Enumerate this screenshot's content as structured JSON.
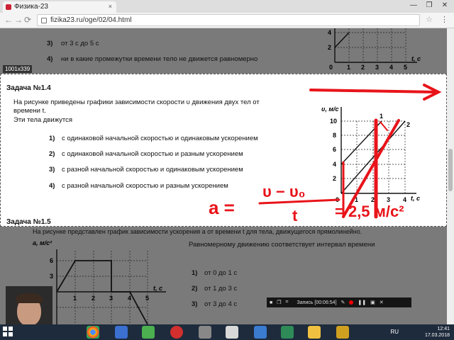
{
  "browser": {
    "tab_title": "Физика-23",
    "tab_close": "×",
    "url": "fizika23.ru/oge/02/04.html",
    "window_controls": [
      "—",
      "❐",
      "✕"
    ]
  },
  "overlay": {
    "size_tag": "1001x339"
  },
  "prev_task": {
    "options": [
      {
        "num": "3)",
        "text": "от 3 с до 5 с"
      },
      {
        "num": "4)",
        "text": "ни в какие промежутки времени тело не движется равномерно"
      }
    ],
    "graph": {
      "y_ticks": [
        "4",
        "2"
      ],
      "x_ticks": [
        "0",
        "1",
        "2",
        "3",
        "4",
        "5"
      ],
      "x_axis": "t, с"
    }
  },
  "task14": {
    "title": "Задача №1.4",
    "question_line1": "На рисунке приведены графики зависимости скорости υ движения двух тел от",
    "question_line2": "времени t.",
    "question_line3": "Эти тела движутся",
    "options": [
      {
        "num": "1)",
        "text": "с одинаковой начальной скоростью и одинаковым ускорением"
      },
      {
        "num": "2)",
        "text": "с одинаковой начальной скоростью и разным ускорением"
      },
      {
        "num": "3)",
        "text": "с разной начальной скоростью и одинаковым ускорением"
      },
      {
        "num": "4)",
        "text": "с разной начальной скоростью и разным ускорением"
      }
    ],
    "graph": {
      "y_axis": "υ, м/с",
      "y_ticks": [
        "10",
        "8",
        "6",
        "4",
        "2"
      ],
      "x_ticks": [
        "0",
        "1",
        "2",
        "3",
        "4"
      ],
      "x_axis": "t, с",
      "line_labels": [
        "1",
        "2"
      ]
    }
  },
  "task15": {
    "title": "Задача №1.5",
    "question": "На рисунке представлен график зависимости ускорения a от времени t для тела, движущегося прямолинейно.",
    "prompt": "Равномерному движению соответствует интервал времени",
    "options": [
      {
        "num": "1)",
        "text": "от 0 до 1 с"
      },
      {
        "num": "2)",
        "text": "от 1 до 3 с"
      },
      {
        "num": "3)",
        "text": "от 3 до 4 с"
      }
    ],
    "graph": {
      "y_axis": "a, м/с²",
      "y_ticks": [
        "6",
        "3"
      ],
      "x_ticks": [
        "1",
        "2",
        "3",
        "4",
        "5"
      ],
      "x_axis": "t, с"
    }
  },
  "handwriting": {
    "formula_left": "a =",
    "formula_num": "υ − υ₀",
    "formula_den": "t",
    "formula_result": "= 2,5 м/с²"
  },
  "recorder": {
    "label": "Запись [00:06:54]"
  },
  "taskbar": {
    "lang": "RU",
    "time": "12:41",
    "date": "17.03.2018"
  },
  "colors": {
    "ink_red": "#e8141a",
    "taskbar": "#1e2b3c"
  }
}
